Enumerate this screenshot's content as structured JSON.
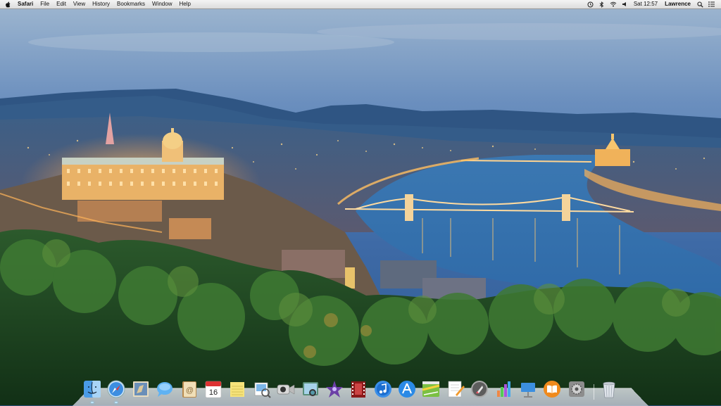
{
  "menubar": {
    "app_name": "Safari",
    "menus": [
      "File",
      "Edit",
      "View",
      "History",
      "Bookmarks",
      "Window",
      "Help"
    ],
    "status": {
      "time": "Sat 12:57",
      "user": "Lawrence"
    },
    "status_icons": [
      "time-machine-icon",
      "bluetooth-icon",
      "wifi-icon",
      "volume-icon"
    ]
  },
  "dock": {
    "apps": [
      {
        "name": "Finder",
        "icon": "finder-icon"
      },
      {
        "name": "Safari",
        "icon": "safari-icon"
      },
      {
        "name": "Mail",
        "icon": "mail-icon"
      },
      {
        "name": "Messages",
        "icon": "messages-icon"
      },
      {
        "name": "Contacts",
        "icon": "contacts-icon"
      },
      {
        "name": "Calendar",
        "icon": "calendar-icon",
        "badge": "16"
      },
      {
        "name": "Notes",
        "icon": "notes-icon"
      },
      {
        "name": "Preview",
        "icon": "preview-icon"
      },
      {
        "name": "FaceTime",
        "icon": "facetime-icon"
      },
      {
        "name": "Photo Booth",
        "icon": "photo-booth-icon"
      },
      {
        "name": "iMovie",
        "icon": "imovie-icon"
      },
      {
        "name": "Photo Viewer",
        "icon": "photo-viewer-icon"
      },
      {
        "name": "iTunes",
        "icon": "itunes-icon"
      },
      {
        "name": "App Store",
        "icon": "app-store-icon"
      },
      {
        "name": "Maps",
        "icon": "maps-icon"
      },
      {
        "name": "Pages",
        "icon": "pages-icon"
      },
      {
        "name": "Launchpad",
        "icon": "launchpad-icon"
      },
      {
        "name": "Keynote Chart",
        "icon": "charts-icon"
      },
      {
        "name": "Keynote",
        "icon": "keynote-icon"
      },
      {
        "name": "iBooks",
        "icon": "ibooks-icon"
      },
      {
        "name": "System Preferences",
        "icon": "system-preferences-icon"
      },
      {
        "name": "Trash",
        "icon": "trash-icon"
      }
    ]
  }
}
